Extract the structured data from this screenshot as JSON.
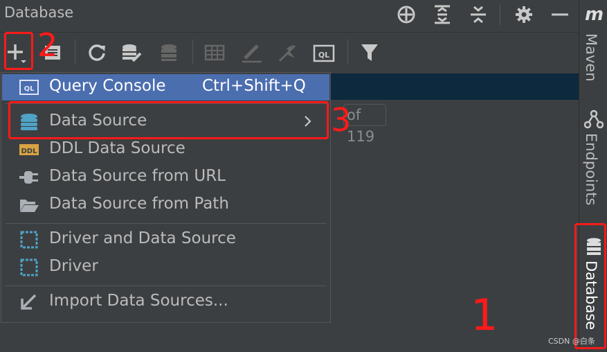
{
  "panel": {
    "title": "Database"
  },
  "menu": {
    "items": [
      {
        "label": "Query Console",
        "shortcut": "Ctrl+Shift+Q",
        "icon": "ql-icon",
        "selected": true
      },
      {
        "label": "Data Source",
        "icon": "database-cylinder-icon",
        "submenu": true
      },
      {
        "label": "DDL Data Source",
        "icon": "ddl-icon"
      },
      {
        "label": "Data Source from URL",
        "icon": "plug-icon"
      },
      {
        "label": "Data Source from Path",
        "icon": "folder-open-icon"
      },
      {
        "label": "Driver and Data Source",
        "icon": "driver-icon"
      },
      {
        "label": "Driver",
        "icon": "driver-icon"
      },
      {
        "label": "Import Data Sources...",
        "icon": "import-arrow-icon"
      }
    ]
  },
  "tree": {
    "badge": "of 119"
  },
  "side_strip": {
    "maven": "Maven",
    "endpoints": "Endpoints",
    "database": "Database"
  },
  "annotations": {
    "n1": "1",
    "n2": "2",
    "n3": "3"
  },
  "watermark": "CSDN @白条",
  "colors": {
    "selection": "#4b6eaf",
    "annotation": "#ff1a1a",
    "background": "#3c3f41"
  }
}
